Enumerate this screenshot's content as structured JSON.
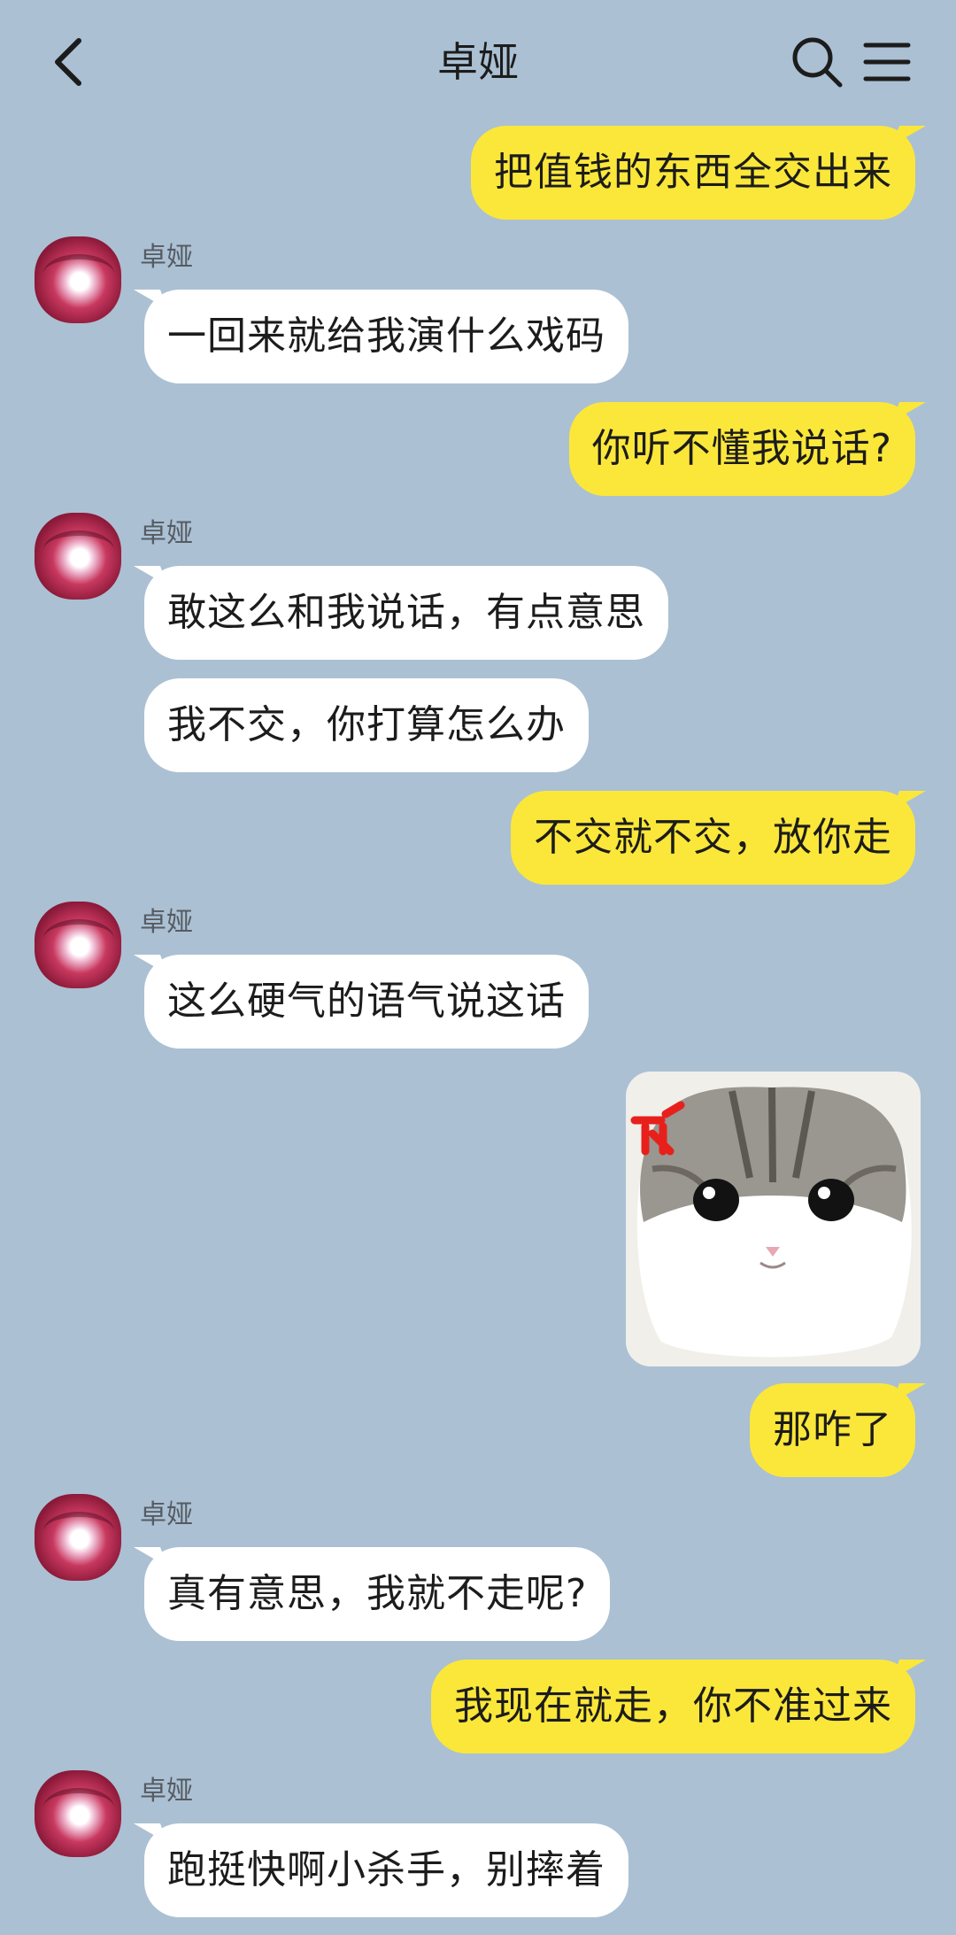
{
  "header": {
    "title": "卓娅",
    "back_icon": "chevron-left-icon",
    "search_icon": "search-icon",
    "menu_icon": "menu-icon"
  },
  "colors": {
    "background": "#abc0d3",
    "outgoing_bubble": "#fbe73a",
    "incoming_bubble": "#ffffff"
  },
  "messages": [
    {
      "type": "out",
      "text": "把值钱的东西全交出来"
    },
    {
      "type": "in",
      "sender": "卓娅",
      "text": "一回来就给我演什么戏码"
    },
    {
      "type": "out",
      "text": "你听不懂我说话?"
    },
    {
      "type": "in",
      "sender": "卓娅",
      "text": "敢这么和我说话，有点意思"
    },
    {
      "type": "in",
      "text": "我不交，你打算怎么办"
    },
    {
      "type": "out",
      "text": "不交就不交，放你走"
    },
    {
      "type": "in",
      "sender": "卓娅",
      "text": "这么硬气的语气说这话"
    },
    {
      "type": "sticker",
      "icon": "angry-cat-sticker"
    },
    {
      "type": "out",
      "text": "那咋了"
    },
    {
      "type": "in",
      "sender": "卓娅",
      "text": "真有意思，我就不走呢?"
    },
    {
      "type": "out",
      "text": "我现在就走，你不准过来"
    },
    {
      "type": "in",
      "sender": "卓娅",
      "text": "跑挺快啊小杀手，别摔着"
    }
  ]
}
